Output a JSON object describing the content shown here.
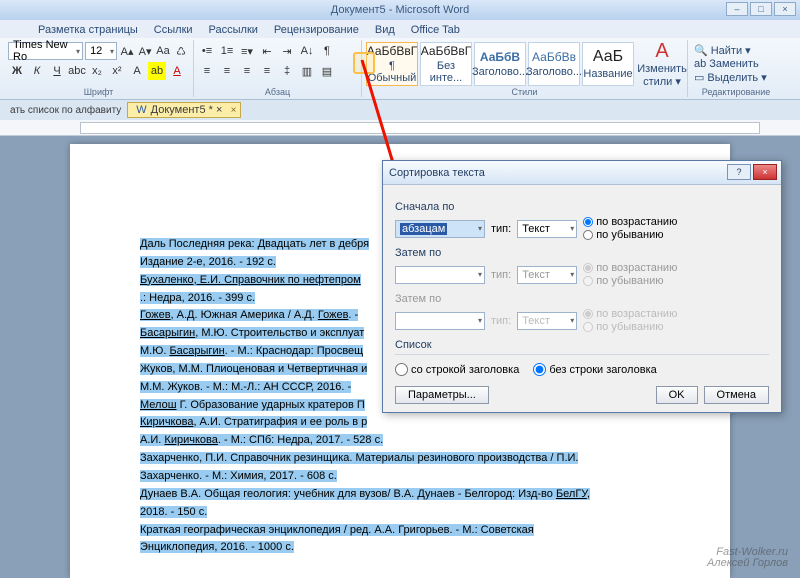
{
  "title": "Документ5 - Microsoft Word",
  "tabs": [
    "Разметка страницы",
    "Ссылки",
    "Рассылки",
    "Рецензирование",
    "Вид",
    "Office Tab"
  ],
  "font": {
    "name": "Times New Ro",
    "size": "12"
  },
  "group_labels": {
    "font": "Шрифт",
    "para": "Абзац",
    "styles": "Стили",
    "edit": "Редактирование"
  },
  "styles": [
    {
      "preview": "АаБбВвГ",
      "label": "¶ Обычный"
    },
    {
      "preview": "АаБбВвГ",
      "label": "Без инте..."
    },
    {
      "preview": "АаБбВ",
      "label": "Заголово..."
    },
    {
      "preview": "АаБбВв",
      "label": "Заголово..."
    },
    {
      "preview": "АаБ",
      "label": "Название"
    }
  ],
  "change_styles": "Изменить\nстили ▾",
  "edit_items": [
    "Найти ▾",
    "Заменить",
    "Выделить ▾"
  ],
  "doctab_left": "ать список по алфавиту",
  "doctab": "Документ5 * ×",
  "doc_lines": [
    "Даль Последняя река: Двадцать лет в дебря",
    "Издание 2-е, 2016. - 192 с.",
    "Бухаленко, Е.И. Справочник по нефтепром",
    ".: Недра, 2016. - 399 с.",
    "Гожев, А.Д. Южная Америка / А.Д. Гожев. -",
    "Басарыгин, М.Ю. Строительство и эксплуат",
    "М.Ю. Басарыгин. - М.: Краснодар: Просвещ",
    "Жуков, М.М. Плиоценовая и Четвертичная и",
    "М.М. Жуков. - М.: М.-Л.: АН СССР, 2016. -",
    "Мелош Г. Образование ударных кратеров П",
    "Киричкова, А.И. Стратиграфия и ее роль в р",
    "А.И. Киричкова. - М.: СПб: Недра, 2017. - 528 с.",
    "Захарченко, П.И. Справочник резинщика. Материалы резинового производства / П.И.",
    "Захарченко. - М.: Химия, 2017. - 608 с.",
    "Дунаев В.А. Общая геология: учебник для вузов/ В.А. Дунаев - Белгород: Изд-во БелГУ,",
    "2018. - 150 с.",
    "Краткая географическая энциклопедия / ред. А.А. Григорьев. - М.: Советская",
    "Энциклопедия, 2016. - 1000 с."
  ],
  "dialog": {
    "title": "Сортировка текста",
    "first_label": "Сначала по",
    "then_label": "Затем по",
    "field_value": "абзацам",
    "field_placeholder": "",
    "type_label": "тип:",
    "type_value": "Текст",
    "asc": "по возрастанию",
    "desc": "по убыванию",
    "list_label": "Список",
    "with_header": "со строкой заголовка",
    "without_header": "без строки заголовка",
    "params": "Параметры...",
    "ok": "OK",
    "cancel": "Отмена"
  },
  "watermark_top": "Fast-Wolker.ru",
  "watermark_bottom": "Алексей Горлов"
}
